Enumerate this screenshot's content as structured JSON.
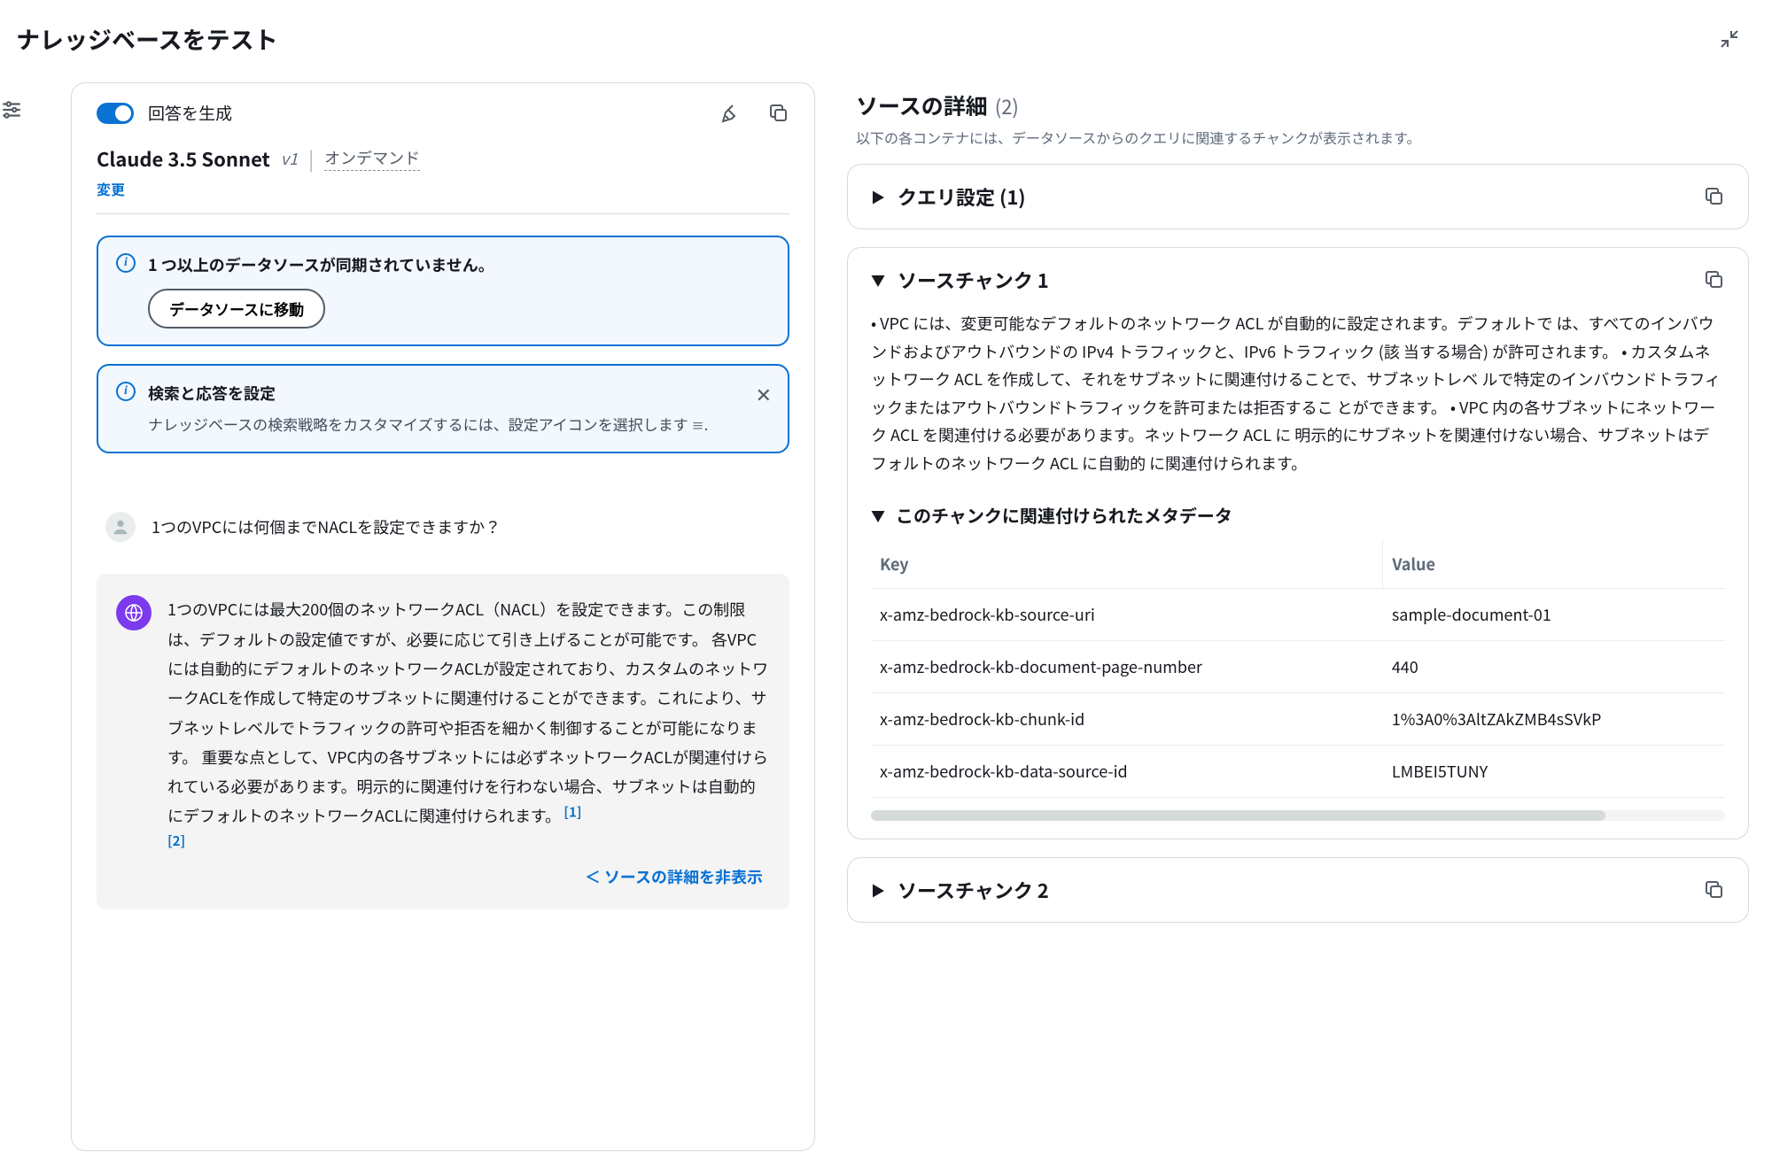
{
  "title": "ナレッジベースをテスト",
  "leftPane": {
    "generateToggleLabel": "回答を生成",
    "model": {
      "name": "Claude 3.5 Sonnet",
      "version": "v1",
      "mode": "オンデマンド"
    },
    "changeLink": "変更",
    "syncWarning": {
      "text": "1 つ以上のデータソースが同期されていません。",
      "button": "データソースに移動"
    },
    "configInfo": {
      "title": "検索と応答を設定",
      "text": "ナレッジベースの検索戦略をカスタマイズするには、設定アイコンを選択します ",
      "iconHint": "≡"
    },
    "userMessage": "1つのVPCには何個までNACLを設定できますか？",
    "assistantMessage": "1つのVPCには最大200個のネットワークACL（NACL）を設定できます。この制限は、デフォルトの設定値ですが、必要に応じて引き上げることが可能です。 各VPCには自動的にデフォルトのネットワークACLが設定されており、カスタムのネットワークACLを作成して特定のサブネットに関連付けることができます。これにより、サブネットレベルでトラフィックの許可や拒否を細かく制御することが可能になります。 重要な点として、VPC内の各サブネットには必ずネットワークACLが関連付けられている必要があります。明示的に関連付けを行わない場合、サブネットは自動的にデフォルトのネットワークACLに関連付けられます。",
    "citations": [
      "[1]",
      "[2]"
    ],
    "hideSource": "＜ ソースの詳細を非表示"
  },
  "rightPane": {
    "title": "ソースの詳細",
    "count": "(2)",
    "subtitle": "以下の各コンテナには、データソースからのクエリに関連するチャンクが表示されます。",
    "querySection": "クエリ設定 (1)",
    "chunk1": {
      "title": "ソースチャンク 1",
      "body": "• VPC には、変更可能なデフォルトのネットワーク ACL が自動的に設定されます。デフォルトで は、すべてのインバウンドおよびアウトバウンドの IPv4 トラフィックと、IPv6 トラフィック (該 当する場合) が許可されます。 • カスタムネットワーク ACL を作成して、それをサブネットに関連付けることで、サブネットレベ ルで特定のインバウンドトラフィックまたはアウトバウンドトラフィックを許可または拒否するこ とができます。 • VPC 内の各サブネットにネットワーク ACL を関連付ける必要があります。ネットワーク ACL に 明示的にサブネットを関連付けない場合、サブネットはデフォルトのネットワーク ACL に自動的 に関連付けられます。",
      "metaTitle": "このチャンクに関連付けられたメタデータ",
      "headers": {
        "key": "Key",
        "value": "Value"
      },
      "rows": [
        {
          "k": "x-amz-bedrock-kb-source-uri",
          "v": "sample-document-01"
        },
        {
          "k": "x-amz-bedrock-kb-document-page-number",
          "v": "440"
        },
        {
          "k": "x-amz-bedrock-kb-chunk-id",
          "v": "1%3A0%3AltZAkZMB4sSVkP"
        },
        {
          "k": "x-amz-bedrock-kb-data-source-id",
          "v": "LMBEI5TUNY"
        }
      ]
    },
    "chunk2": {
      "title": "ソースチャンク 2"
    }
  }
}
